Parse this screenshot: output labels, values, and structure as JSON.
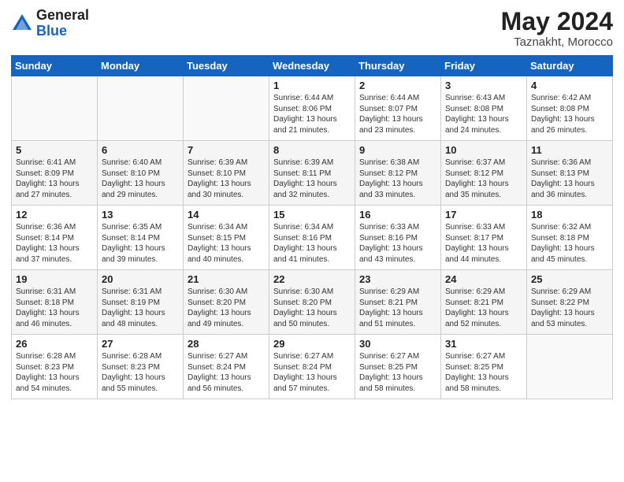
{
  "header": {
    "logo_general": "General",
    "logo_blue": "Blue",
    "main_title": "May 2024",
    "subtitle": "Taznakht, Morocco"
  },
  "days_of_week": [
    "Sunday",
    "Monday",
    "Tuesday",
    "Wednesday",
    "Thursday",
    "Friday",
    "Saturday"
  ],
  "weeks": [
    [
      {
        "day": "",
        "info": ""
      },
      {
        "day": "",
        "info": ""
      },
      {
        "day": "",
        "info": ""
      },
      {
        "day": "1",
        "info": "Sunrise: 6:44 AM\nSunset: 8:06 PM\nDaylight: 13 hours\nand 21 minutes."
      },
      {
        "day": "2",
        "info": "Sunrise: 6:44 AM\nSunset: 8:07 PM\nDaylight: 13 hours\nand 23 minutes."
      },
      {
        "day": "3",
        "info": "Sunrise: 6:43 AM\nSunset: 8:08 PM\nDaylight: 13 hours\nand 24 minutes."
      },
      {
        "day": "4",
        "info": "Sunrise: 6:42 AM\nSunset: 8:08 PM\nDaylight: 13 hours\nand 26 minutes."
      }
    ],
    [
      {
        "day": "5",
        "info": "Sunrise: 6:41 AM\nSunset: 8:09 PM\nDaylight: 13 hours\nand 27 minutes."
      },
      {
        "day": "6",
        "info": "Sunrise: 6:40 AM\nSunset: 8:10 PM\nDaylight: 13 hours\nand 29 minutes."
      },
      {
        "day": "7",
        "info": "Sunrise: 6:39 AM\nSunset: 8:10 PM\nDaylight: 13 hours\nand 30 minutes."
      },
      {
        "day": "8",
        "info": "Sunrise: 6:39 AM\nSunset: 8:11 PM\nDaylight: 13 hours\nand 32 minutes."
      },
      {
        "day": "9",
        "info": "Sunrise: 6:38 AM\nSunset: 8:12 PM\nDaylight: 13 hours\nand 33 minutes."
      },
      {
        "day": "10",
        "info": "Sunrise: 6:37 AM\nSunset: 8:12 PM\nDaylight: 13 hours\nand 35 minutes."
      },
      {
        "day": "11",
        "info": "Sunrise: 6:36 AM\nSunset: 8:13 PM\nDaylight: 13 hours\nand 36 minutes."
      }
    ],
    [
      {
        "day": "12",
        "info": "Sunrise: 6:36 AM\nSunset: 8:14 PM\nDaylight: 13 hours\nand 37 minutes."
      },
      {
        "day": "13",
        "info": "Sunrise: 6:35 AM\nSunset: 8:14 PM\nDaylight: 13 hours\nand 39 minutes."
      },
      {
        "day": "14",
        "info": "Sunrise: 6:34 AM\nSunset: 8:15 PM\nDaylight: 13 hours\nand 40 minutes."
      },
      {
        "day": "15",
        "info": "Sunrise: 6:34 AM\nSunset: 8:16 PM\nDaylight: 13 hours\nand 41 minutes."
      },
      {
        "day": "16",
        "info": "Sunrise: 6:33 AM\nSunset: 8:16 PM\nDaylight: 13 hours\nand 43 minutes."
      },
      {
        "day": "17",
        "info": "Sunrise: 6:33 AM\nSunset: 8:17 PM\nDaylight: 13 hours\nand 44 minutes."
      },
      {
        "day": "18",
        "info": "Sunrise: 6:32 AM\nSunset: 8:18 PM\nDaylight: 13 hours\nand 45 minutes."
      }
    ],
    [
      {
        "day": "19",
        "info": "Sunrise: 6:31 AM\nSunset: 8:18 PM\nDaylight: 13 hours\nand 46 minutes."
      },
      {
        "day": "20",
        "info": "Sunrise: 6:31 AM\nSunset: 8:19 PM\nDaylight: 13 hours\nand 48 minutes."
      },
      {
        "day": "21",
        "info": "Sunrise: 6:30 AM\nSunset: 8:20 PM\nDaylight: 13 hours\nand 49 minutes."
      },
      {
        "day": "22",
        "info": "Sunrise: 6:30 AM\nSunset: 8:20 PM\nDaylight: 13 hours\nand 50 minutes."
      },
      {
        "day": "23",
        "info": "Sunrise: 6:29 AM\nSunset: 8:21 PM\nDaylight: 13 hours\nand 51 minutes."
      },
      {
        "day": "24",
        "info": "Sunrise: 6:29 AM\nSunset: 8:21 PM\nDaylight: 13 hours\nand 52 minutes."
      },
      {
        "day": "25",
        "info": "Sunrise: 6:29 AM\nSunset: 8:22 PM\nDaylight: 13 hours\nand 53 minutes."
      }
    ],
    [
      {
        "day": "26",
        "info": "Sunrise: 6:28 AM\nSunset: 8:23 PM\nDaylight: 13 hours\nand 54 minutes."
      },
      {
        "day": "27",
        "info": "Sunrise: 6:28 AM\nSunset: 8:23 PM\nDaylight: 13 hours\nand 55 minutes."
      },
      {
        "day": "28",
        "info": "Sunrise: 6:27 AM\nSunset: 8:24 PM\nDaylight: 13 hours\nand 56 minutes."
      },
      {
        "day": "29",
        "info": "Sunrise: 6:27 AM\nSunset: 8:24 PM\nDaylight: 13 hours\nand 57 minutes."
      },
      {
        "day": "30",
        "info": "Sunrise: 6:27 AM\nSunset: 8:25 PM\nDaylight: 13 hours\nand 58 minutes."
      },
      {
        "day": "31",
        "info": "Sunrise: 6:27 AM\nSunset: 8:25 PM\nDaylight: 13 hours\nand 58 minutes."
      },
      {
        "day": "",
        "info": ""
      }
    ]
  ]
}
